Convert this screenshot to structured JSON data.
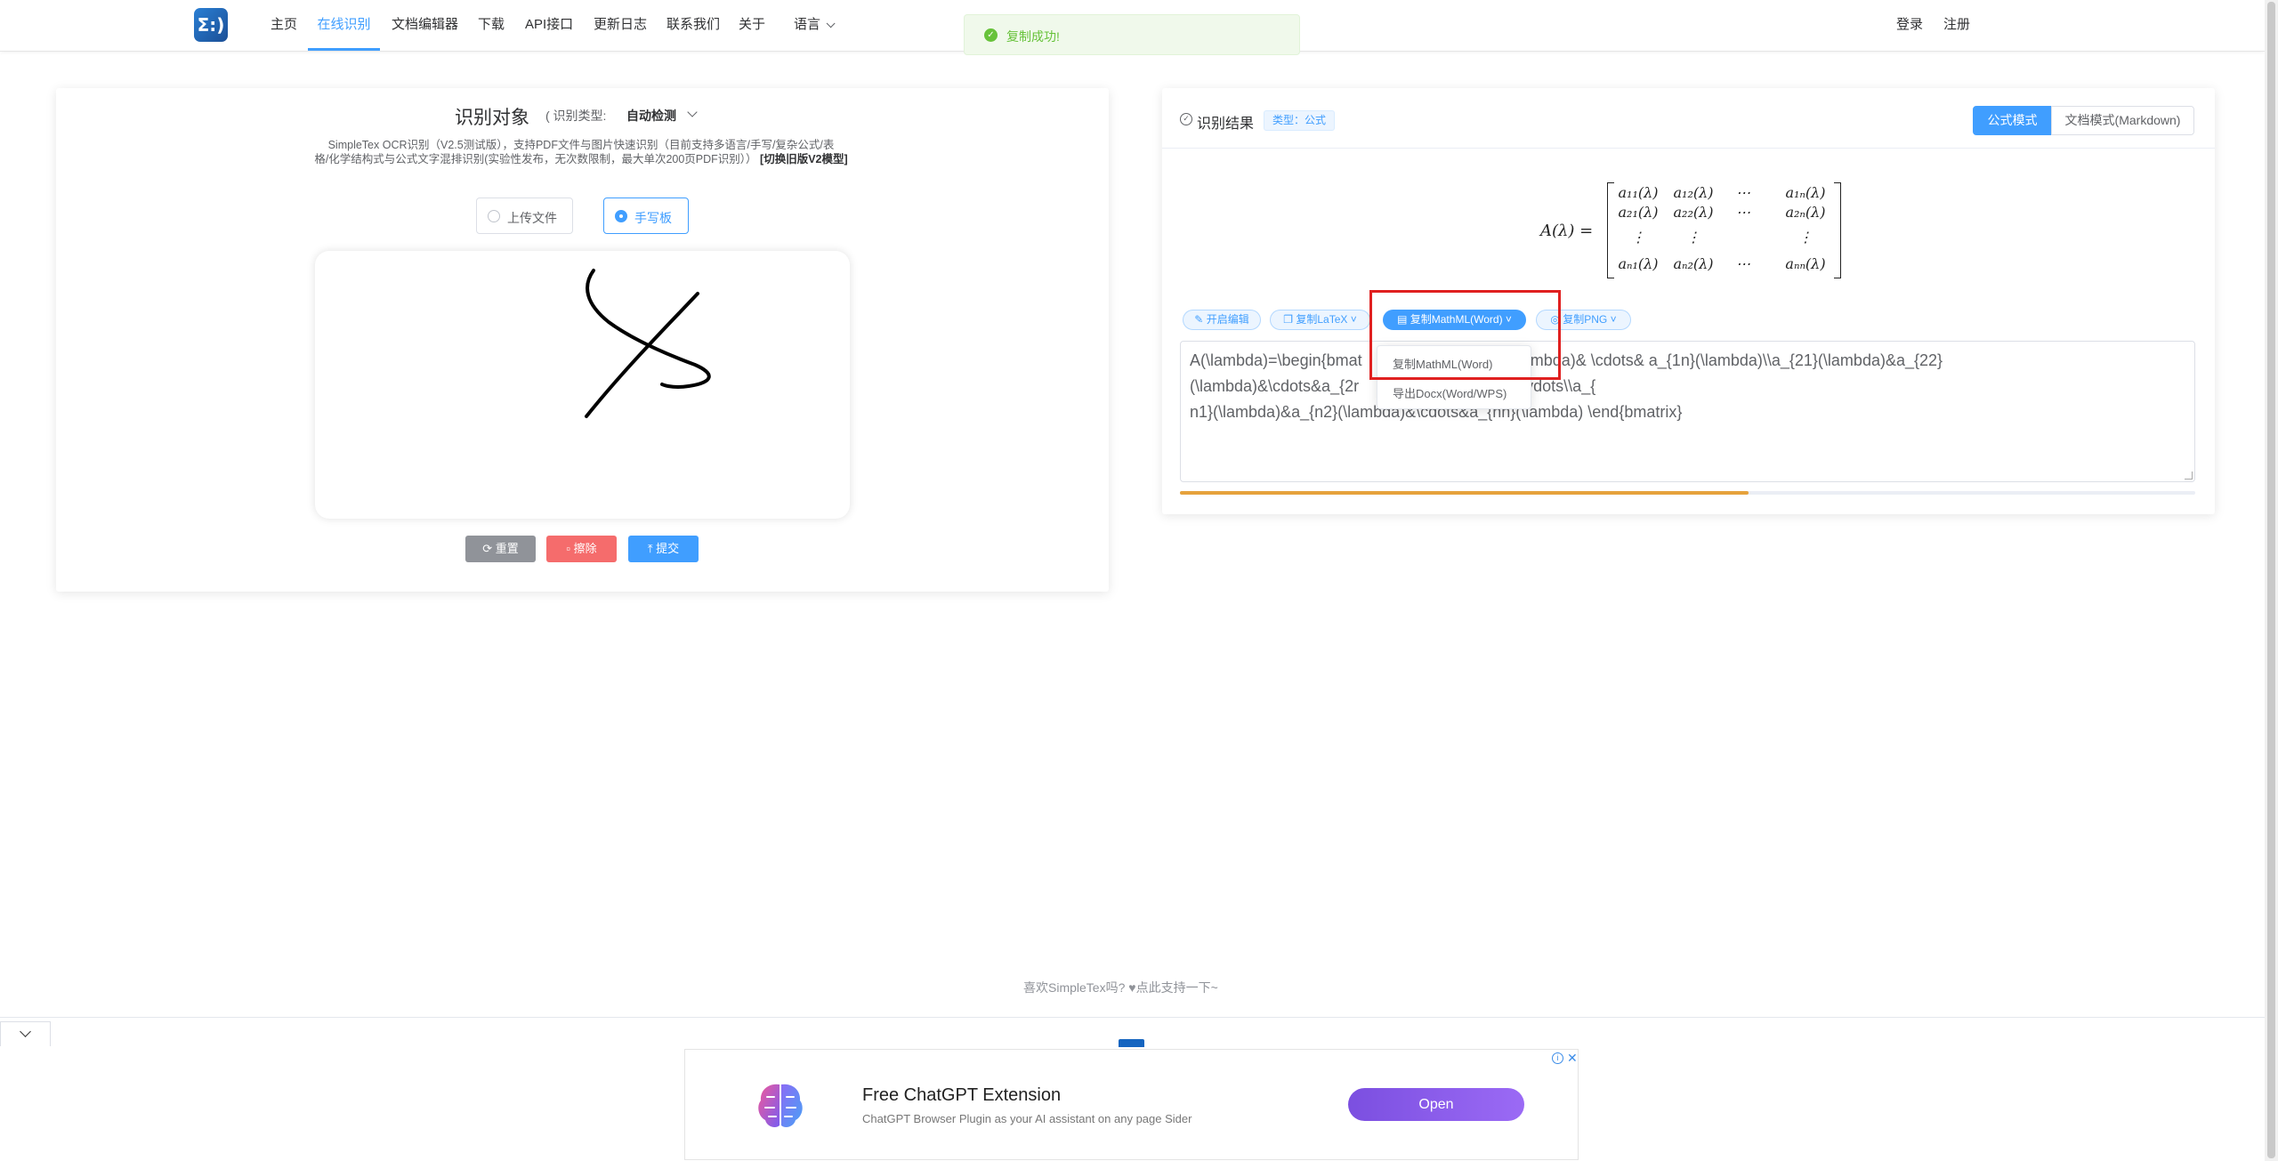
{
  "nav": {
    "logo_text": "Σ:)",
    "items": [
      "主页",
      "在线识别",
      "文档编辑器",
      "下载",
      "API接口",
      "更新日志",
      "联系我们",
      "关于",
      "语言"
    ],
    "login": "登录",
    "register": "注册"
  },
  "toast": {
    "text": "复制成功!"
  },
  "left": {
    "title": "识别对象",
    "type_label": "( 识别类型:",
    "type_value": "自动检测",
    "desc_line1": "SimpleTex OCR识别（V2.5测试版），支持PDF文件与图片快速识别（目前支持多语言/手写/复杂公式/表",
    "desc_line2": "格/化学结构式与公式文字混排识别(实验性发布，无次数限制，最大单次200页PDF识别））",
    "desc_link": "[切换旧版V2模型]",
    "upload_label": "上传文件",
    "handwrite_label": "手写板",
    "btn_reset": "重置",
    "btn_erase": "擦除",
    "btn_submit": "提交"
  },
  "right": {
    "title": "识别结果",
    "badge": "类型：公式",
    "mode_formula": "公式模式",
    "mode_doc": "文档模式(Markdown)",
    "tools": {
      "edit": "开启编辑",
      "latex": "复制LaTeX",
      "mathml": "复制MathML(Word)",
      "png": "复制PNG"
    },
    "latex_line1": "A(\\lambda)=\\begin{bmat                    &a_{12}(\\lambda)& \\cdots& a_{1n}(\\lambda)\\\\a_{21}(\\lambda)&a_{22}",
    "latex_line2": "(\\lambda)&\\cdots&a_{2r                    \\vdots& & \\vdots\\\\a_{",
    "latex_line3": "n1}(\\lambda)&a_{n2}(\\lambda)&\\cdots&a_{nn}(\\lambda) \\end{bmatrix}",
    "progress": 0.56,
    "formula": {
      "lhs": "A(λ) =",
      "row1": [
        "a₁₁(λ)",
        "a₁₂(λ)",
        "⋯",
        "a₁ₙ(λ)"
      ],
      "row2": [
        "a₂₁(λ)",
        "a₂₂(λ)",
        "⋯",
        "a₂ₙ(λ)"
      ],
      "row3": [
        "⋮",
        "⋮",
        "",
        "⋮"
      ],
      "row4": [
        "aₙ₁(λ)",
        "aₙ₂(λ)",
        "⋯",
        "aₙₙ(λ)"
      ]
    }
  },
  "dropdown": {
    "item1": "复制MathML(Word)",
    "item2": "导出Docx(Word/WPS)"
  },
  "footer": {
    "support": "喜欢SimpleTex吗? ♥点此支持一下~"
  },
  "ad": {
    "title": "Free ChatGPT Extension",
    "subtitle": "ChatGPT Browser Plugin as your AI assistant on any page Sider",
    "open": "Open"
  },
  "colors": {
    "accent": "#409eff",
    "success": "#67c23a",
    "danger": "#f56c6c",
    "highlight": "#e02020",
    "progress": "#e6a23c"
  }
}
